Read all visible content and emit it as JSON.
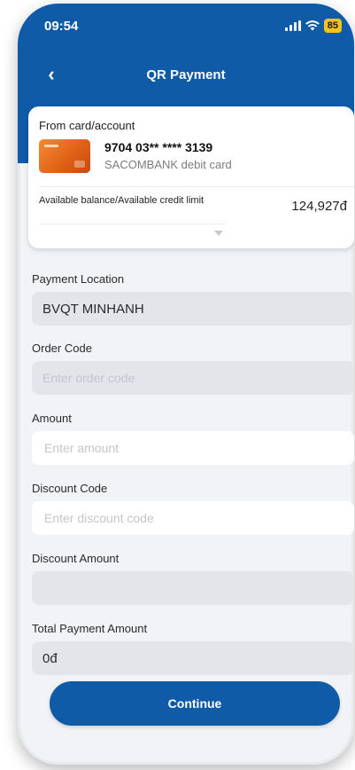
{
  "status_bar": {
    "time": "09:54",
    "battery": "85"
  },
  "nav": {
    "title": "QR Payment"
  },
  "account_card": {
    "label": "From card/account",
    "card_number": "9704 03** **** 3139",
    "card_type": "SACOMBANK debit card",
    "balance_label": "Available balance/Available credit limit",
    "balance_value": "124,927đ"
  },
  "form": {
    "payment_location": {
      "label": "Payment Location",
      "value": "BVQT MINHANH"
    },
    "order_code": {
      "label": "Order Code",
      "placeholder": "Enter order code"
    },
    "amount": {
      "label": "Amount",
      "placeholder": "Enter amount"
    },
    "discount_code": {
      "label": "Discount Code",
      "placeholder": "Enter discount code"
    },
    "discount_amount": {
      "label": "Discount Amount",
      "value": ""
    },
    "total_payment": {
      "label": "Total Payment Amount",
      "value": "0đ"
    }
  },
  "actions": {
    "continue_label": "Continue"
  },
  "colors": {
    "brand_blue": "#0f5ba8",
    "battery_yellow": "#f5c21b",
    "field_gray": "#e3e5ea"
  }
}
